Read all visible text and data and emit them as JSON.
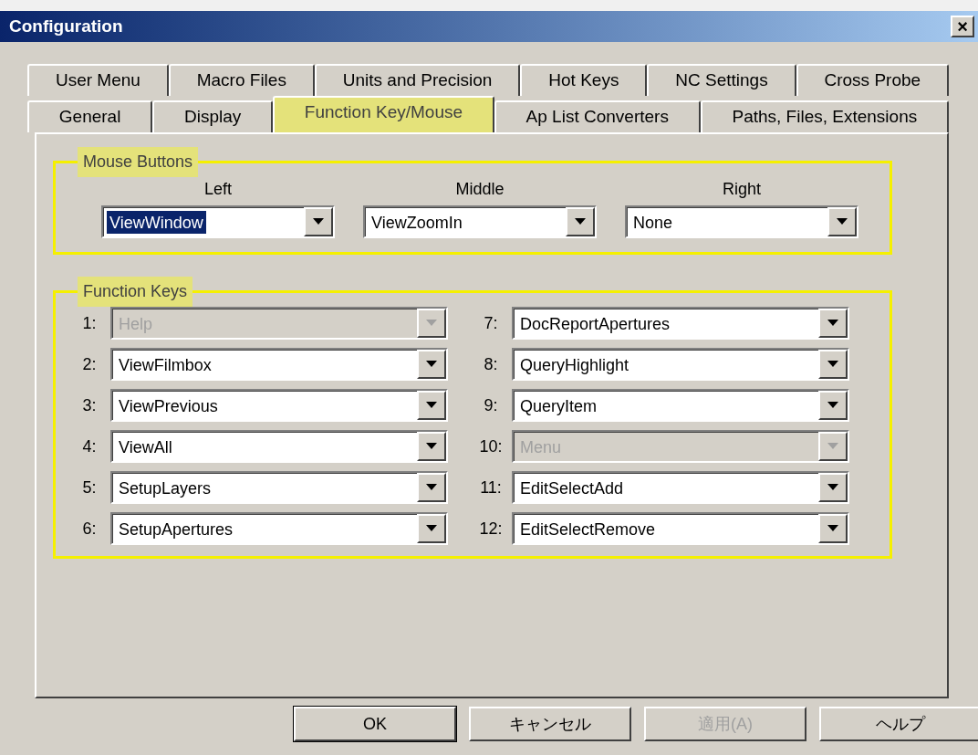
{
  "window": {
    "title": "Configuration",
    "close": "×"
  },
  "tab_rows": [
    [
      {
        "label": "User Menu",
        "selected": false,
        "highlighted": false
      },
      {
        "label": "Macro Files",
        "selected": false,
        "highlighted": false
      },
      {
        "label": "Units and Precision",
        "selected": false,
        "highlighted": false
      },
      {
        "label": "Hot Keys",
        "selected": false,
        "highlighted": false
      },
      {
        "label": "NC Settings",
        "selected": false,
        "highlighted": false
      },
      {
        "label": "Cross Probe",
        "selected": false,
        "highlighted": false
      }
    ],
    [
      {
        "label": "General",
        "selected": false,
        "highlighted": false
      },
      {
        "label": "Display",
        "selected": false,
        "highlighted": false
      },
      {
        "label": "Function Key/Mouse",
        "selected": true,
        "highlighted": true
      },
      {
        "label": "Ap List Converters",
        "selected": false,
        "highlighted": false
      },
      {
        "label": "Paths, Files, Extensions",
        "selected": false,
        "highlighted": false
      }
    ]
  ],
  "mouse_buttons": {
    "title": "Mouse Buttons",
    "highlighted": true,
    "buttons": [
      {
        "label": "Left",
        "value": "ViewWindow",
        "selected": true,
        "disabled": false
      },
      {
        "label": "Middle",
        "value": "ViewZoomIn",
        "selected": false,
        "disabled": false
      },
      {
        "label": "Right",
        "value": "None",
        "selected": false,
        "disabled": false
      }
    ]
  },
  "function_keys": {
    "title": "Function Keys",
    "highlighted": true,
    "keys": [
      {
        "label": "1:",
        "value": "Help",
        "disabled": true
      },
      {
        "label": "2:",
        "value": "ViewFilmbox",
        "disabled": false
      },
      {
        "label": "3:",
        "value": "ViewPrevious",
        "disabled": false
      },
      {
        "label": "4:",
        "value": "ViewAll",
        "disabled": false
      },
      {
        "label": "5:",
        "value": "SetupLayers",
        "disabled": false
      },
      {
        "label": "6:",
        "value": "SetupApertures",
        "disabled": false
      },
      {
        "label": "7:",
        "value": "DocReportApertures",
        "disabled": false
      },
      {
        "label": "8:",
        "value": "QueryHighlight",
        "disabled": false
      },
      {
        "label": "9:",
        "value": "QueryItem",
        "disabled": false
      },
      {
        "label": "10:",
        "value": "Menu",
        "disabled": true
      },
      {
        "label": "11:",
        "value": "EditSelectAdd",
        "disabled": false
      },
      {
        "label": "12:",
        "value": "EditSelectRemove",
        "disabled": false
      }
    ]
  },
  "buttons": [
    {
      "label": "OK",
      "default": true,
      "disabled": false
    },
    {
      "label": "キャンセル",
      "default": false,
      "disabled": false
    },
    {
      "label": "適用(A)",
      "default": false,
      "disabled": true
    },
    {
      "label": "ヘルプ",
      "default": false,
      "disabled": false
    }
  ]
}
